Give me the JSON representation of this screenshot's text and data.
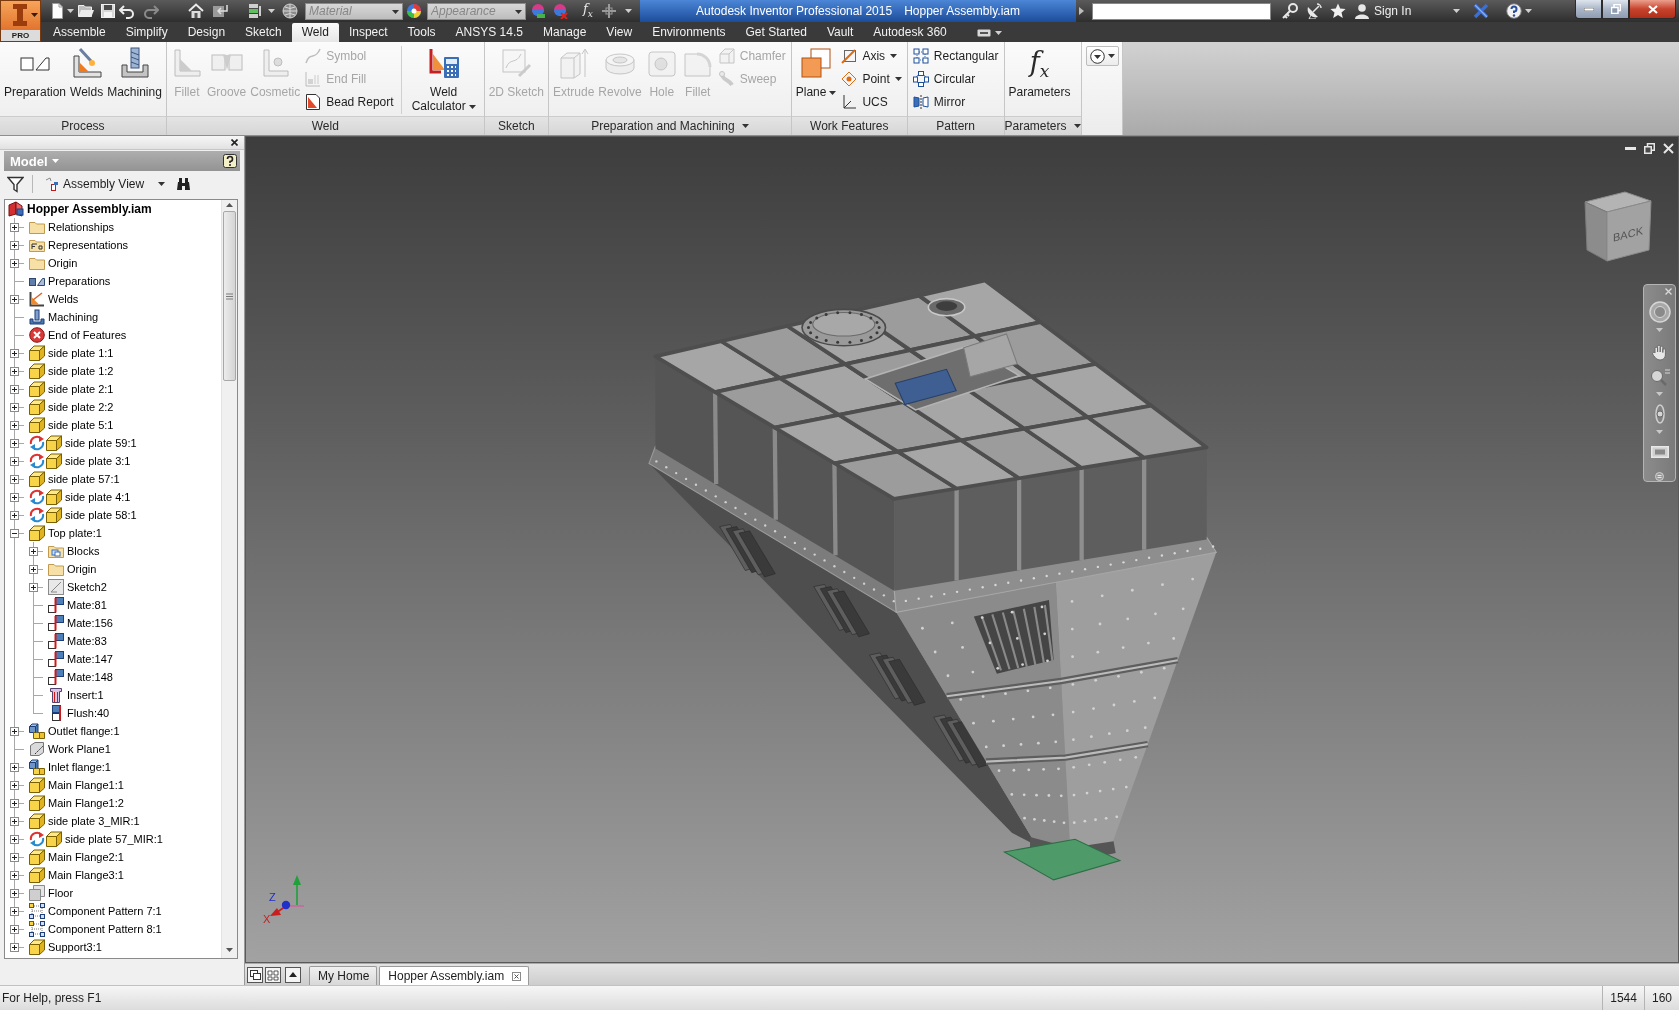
{
  "app_button": {
    "badge": "PRO"
  },
  "quick_access": {
    "redo": {
      "disabled": true
    },
    "material": {
      "placeholder": "Material"
    },
    "appearance": {
      "placeholder": "Appearance"
    },
    "formula": "f$_{x}$"
  },
  "title_bar": {
    "app_title": "Autodesk Inventor Professional 2015",
    "document_title": "Hopper Assembly.iam",
    "sign_in": "Sign In"
  },
  "ribbon_tabs": [
    {
      "label": "Assemble",
      "selected": false
    },
    {
      "label": "Simplify",
      "selected": false
    },
    {
      "label": "Design",
      "selected": false
    },
    {
      "label": "Sketch",
      "selected": false
    },
    {
      "label": "Weld",
      "selected": true
    },
    {
      "label": "Inspect",
      "selected": false
    },
    {
      "label": "Tools",
      "selected": false
    },
    {
      "label": "ANSYS 14.5",
      "selected": false
    },
    {
      "label": "Manage",
      "selected": false
    },
    {
      "label": "View",
      "selected": false
    },
    {
      "label": "Environments",
      "selected": false
    },
    {
      "label": "Get Started",
      "selected": false
    },
    {
      "label": "Vault",
      "selected": false
    },
    {
      "label": "Autodesk 360",
      "selected": false
    }
  ],
  "ribbon_panels": [
    {
      "title": "Process",
      "menu": false,
      "columns": [
        {
          "kind": "large",
          "label": "Preparation",
          "disabled": false,
          "dropdown": false
        },
        {
          "kind": "large",
          "label": "Welds",
          "disabled": false,
          "dropdown": false
        },
        {
          "kind": "large",
          "label": "Machining",
          "disabled": false,
          "dropdown": false
        }
      ]
    },
    {
      "title": "Weld",
      "menu": false,
      "columns": [
        {
          "kind": "large",
          "label": "Fillet",
          "disabled": true,
          "dropdown": false
        },
        {
          "kind": "large",
          "label": "Groove",
          "disabled": true,
          "dropdown": false
        },
        {
          "kind": "large",
          "label": "Cosmetic",
          "disabled": true,
          "dropdown": false
        },
        {
          "kind": "stack",
          "items": [
            {
              "label": "Symbol",
              "disabled": true,
              "dropdown": false
            },
            {
              "label": "End Fill",
              "disabled": true,
              "dropdown": false
            },
            {
              "label": "Bead Report",
              "disabled": false,
              "dropdown": false
            }
          ]
        },
        {
          "kind": "separator"
        },
        {
          "kind": "large",
          "label": "Weld Calculator",
          "disabled": false,
          "dropdown": true
        }
      ]
    },
    {
      "title": "Sketch",
      "menu": false,
      "columns": [
        {
          "kind": "large",
          "label": "2D Sketch",
          "disabled": true,
          "dropdown": false
        }
      ]
    },
    {
      "title": "Preparation and Machining",
      "menu": true,
      "columns": [
        {
          "kind": "large",
          "label": "Extrude",
          "disabled": true,
          "dropdown": false
        },
        {
          "kind": "large",
          "label": "Revolve",
          "disabled": true,
          "dropdown": false
        },
        {
          "kind": "large",
          "label": "Hole",
          "disabled": true,
          "dropdown": false
        },
        {
          "kind": "large",
          "label": "Fillet",
          "disabled": true,
          "dropdown": false
        },
        {
          "kind": "stack",
          "items": [
            {
              "label": "Chamfer",
              "disabled": true,
              "dropdown": false
            },
            {
              "label": "Sweep",
              "disabled": true,
              "dropdown": false
            }
          ]
        }
      ]
    },
    {
      "title": "Work Features",
      "menu": false,
      "columns": [
        {
          "kind": "large",
          "label": "Plane",
          "disabled": false,
          "dropdown": true
        },
        {
          "kind": "stack",
          "items": [
            {
              "label": "Axis",
              "disabled": false,
              "dropdown": true
            },
            {
              "label": "Point",
              "disabled": false,
              "dropdown": true
            },
            {
              "label": "UCS",
              "disabled": false,
              "dropdown": false
            }
          ]
        }
      ]
    },
    {
      "title": "Pattern",
      "menu": false,
      "columns": [
        {
          "kind": "stack",
          "items": [
            {
              "label": "Rectangular",
              "disabled": false,
              "dropdown": false
            },
            {
              "label": "Circular",
              "disabled": false,
              "dropdown": false
            },
            {
              "label": "Mirror",
              "disabled": false,
              "dropdown": false
            }
          ]
        }
      ]
    },
    {
      "title": "Parameters",
      "menu": true,
      "columns": [
        {
          "kind": "large",
          "label": "Parameters",
          "glyph": "f$_{x}$",
          "disabled": false,
          "dropdown": false
        }
      ]
    }
  ],
  "browser": {
    "title": "Model",
    "view": "Assembly View"
  },
  "model_tree": {
    "label": "Hopper Assembly.iam",
    "kind": "assembly",
    "children": [
      {
        "label": "Relationships",
        "kind": "folder",
        "expanded": false,
        "needs_update": false
      },
      {
        "label": "Representations",
        "kind": "representations",
        "expanded": false,
        "needs_update": false
      },
      {
        "label": "Origin",
        "kind": "folder",
        "expanded": false,
        "needs_update": false
      },
      {
        "label": "Preparations",
        "kind": "preparations",
        "needs_update": false
      },
      {
        "label": "Welds",
        "kind": "welds",
        "expanded": false,
        "needs_update": false
      },
      {
        "label": "Machining",
        "kind": "machining",
        "needs_update": false
      },
      {
        "label": "End of Features",
        "kind": "end-of-features",
        "needs_update": false
      },
      {
        "label": "side plate 1:1",
        "kind": "part",
        "expanded": false,
        "needs_update": false
      },
      {
        "label": "side plate 1:2",
        "kind": "part",
        "expanded": false,
        "needs_update": false
      },
      {
        "label": "side plate 2:1",
        "kind": "part",
        "expanded": false,
        "needs_update": false
      },
      {
        "label": "side plate 2:2",
        "kind": "part",
        "expanded": false,
        "needs_update": false
      },
      {
        "label": "side plate 5:1",
        "kind": "part",
        "expanded": false,
        "needs_update": false
      },
      {
        "label": "side plate 59:1",
        "kind": "part",
        "expanded": false,
        "needs_update": true
      },
      {
        "label": "side plate 3:1",
        "kind": "part",
        "expanded": false,
        "needs_update": true
      },
      {
        "label": "side plate 57:1",
        "kind": "part",
        "expanded": false,
        "needs_update": false
      },
      {
        "label": "side plate 4:1",
        "kind": "part",
        "expanded": false,
        "needs_update": true
      },
      {
        "label": "side plate 58:1",
        "kind": "part",
        "expanded": false,
        "needs_update": true
      },
      {
        "label": "Top plate:1",
        "kind": "part",
        "expanded": true,
        "needs_update": false,
        "children": [
          {
            "label": "Blocks",
            "kind": "blocks",
            "expanded": false,
            "needs_update": false
          },
          {
            "label": "Origin",
            "kind": "folder",
            "expanded": false,
            "needs_update": false
          },
          {
            "label": "Sketch2",
            "kind": "sketch",
            "expanded": false,
            "needs_update": false
          },
          {
            "label": "Mate:81",
            "kind": "mate",
            "needs_update": false
          },
          {
            "label": "Mate:156",
            "kind": "mate",
            "needs_update": false
          },
          {
            "label": "Mate:83",
            "kind": "mate",
            "needs_update": false
          },
          {
            "label": "Mate:147",
            "kind": "mate",
            "needs_update": false
          },
          {
            "label": "Mate:148",
            "kind": "mate",
            "needs_update": false
          },
          {
            "label": "Insert:1",
            "kind": "insert",
            "needs_update": false
          },
          {
            "label": "Flush:40",
            "kind": "flush",
            "needs_update": false
          }
        ]
      },
      {
        "label": "Outlet flange:1",
        "kind": "subassembly",
        "expanded": false,
        "needs_update": false
      },
      {
        "label": "Work Plane1",
        "kind": "work-plane",
        "needs_update": false
      },
      {
        "label": "Inlet flange:1",
        "kind": "subassembly",
        "expanded": false,
        "needs_update": false
      },
      {
        "label": "Main Flange1:1",
        "kind": "part",
        "expanded": false,
        "needs_update": false
      },
      {
        "label": "Main Flange1:2",
        "kind": "part",
        "expanded": false,
        "needs_update": false
      },
      {
        "label": "side plate 3_MIR:1",
        "kind": "part",
        "expanded": false,
        "needs_update": false
      },
      {
        "label": "side plate 57_MIR:1",
        "kind": "part",
        "expanded": false,
        "needs_update": true
      },
      {
        "label": "Main Flange2:1",
        "kind": "part",
        "expanded": false,
        "needs_update": false
      },
      {
        "label": "Main Flange3:1",
        "kind": "part",
        "expanded": false,
        "needs_update": false
      },
      {
        "label": "Floor",
        "kind": "floor",
        "expanded": false,
        "needs_update": false
      },
      {
        "label": "Component Pattern 7:1",
        "kind": "pattern",
        "expanded": false,
        "needs_update": false
      },
      {
        "label": "Component Pattern 8:1",
        "kind": "pattern",
        "expanded": false,
        "needs_update": false
      },
      {
        "label": "Support3:1",
        "kind": "part",
        "expanded": false,
        "needs_update": false
      }
    ]
  },
  "view_cube": {
    "face_label": "BACK"
  },
  "axis_triad": [
    {
      "label": "Z",
      "color": "#2030c8"
    },
    {
      "label": "X",
      "color": "#c81e1e"
    }
  ],
  "document_tabs": [
    {
      "label": "My Home",
      "selected": false
    },
    {
      "label": "Hopper Assembly.iam",
      "selected": true
    }
  ],
  "status_bar": {
    "message": "For Help, press F1",
    "cells": [
      "1544",
      "160"
    ]
  }
}
